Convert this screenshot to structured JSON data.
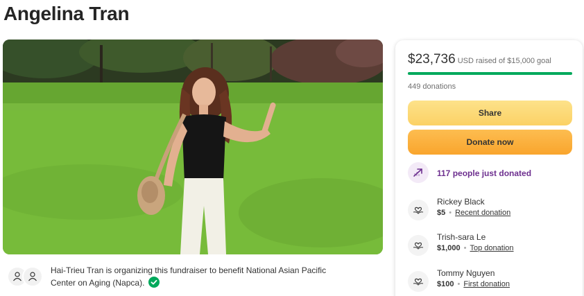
{
  "page": {
    "title": "Angelina Tran"
  },
  "organizer": {
    "text": "Hai-Trieu Tran is organizing this fundraiser to benefit National Asian Pacific Center on Aging (Napca).",
    "avatar_icons": [
      "person-icon",
      "person-icon"
    ],
    "verified_icon": "check-circle-icon",
    "verified_color": "#02a95c"
  },
  "donation_card": {
    "amount": "$23,736",
    "amount_suffix": "USD raised of $15,000 goal",
    "progress": 1.0,
    "progress_color": "#02a95c",
    "donation_count": "449 donations",
    "share_label": "Share",
    "donate_label": "Donate now",
    "trend_text": "117 people just donated",
    "trend_color": "#6d2f8f",
    "donors": [
      {
        "name": "Rickey Black",
        "amount": "$5",
        "tag": "Recent donation"
      },
      {
        "name": "Trish-sara Le",
        "amount": "$1,000",
        "tag": "Top donation"
      },
      {
        "name": "Tommy Nguyen",
        "amount": "$100",
        "tag": "First donation"
      }
    ]
  },
  "colors": {
    "share_button": "#fbd165",
    "donate_button": "#f9a52d",
    "accent_green": "#02a95c"
  }
}
